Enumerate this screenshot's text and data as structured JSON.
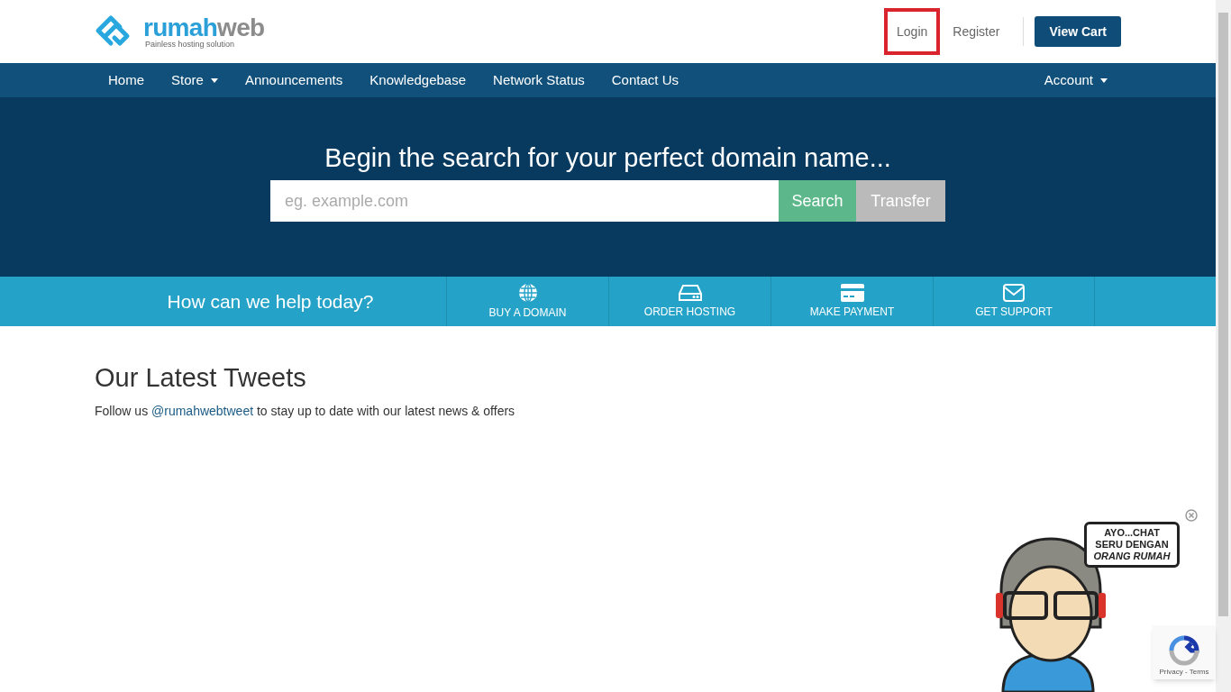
{
  "logo": {
    "name_part_1": "rumah",
    "name_part_2": "web",
    "tagline": "Painless hosting solution"
  },
  "top_links": [
    {
      "label": "Login",
      "highlighted": true
    },
    {
      "label": "Register",
      "highlighted": false
    }
  ],
  "cart_button": "View Cart",
  "nav": {
    "items": [
      {
        "label": "Home",
        "dropdown": false
      },
      {
        "label": "Store",
        "dropdown": true
      },
      {
        "label": "Announcements",
        "dropdown": false
      },
      {
        "label": "Knowledgebase",
        "dropdown": false
      },
      {
        "label": "Network Status",
        "dropdown": false
      },
      {
        "label": "Contact Us",
        "dropdown": false
      }
    ],
    "account": {
      "label": "Account",
      "dropdown": true
    }
  },
  "hero": {
    "title": "Begin the search for your perfect domain name...",
    "placeholder": "eg. example.com",
    "search_button": "Search",
    "transfer_button": "Transfer"
  },
  "help_bar": {
    "title": "How can we help today?",
    "tiles": [
      {
        "kind": "globe",
        "label": "BUY A DOMAIN"
      },
      {
        "kind": "server",
        "label": "ORDER HOSTING"
      },
      {
        "kind": "card",
        "label": "MAKE PAYMENT"
      },
      {
        "kind": "mail",
        "label": "GET SUPPORT"
      }
    ]
  },
  "tweets": {
    "title": "Our Latest Tweets",
    "text_before": "Follow us ",
    "link": "@rumahwebtweet",
    "text_after": " to stay up to date with our latest news & offers"
  },
  "chat_widget": {
    "bubble_lines": [
      "AYO...CHAT",
      "SERU DENGAN",
      "ORANG RUMAH"
    ]
  },
  "recaptcha": {
    "privacy": "Privacy",
    "separator": "-",
    "terms": "Terms"
  }
}
